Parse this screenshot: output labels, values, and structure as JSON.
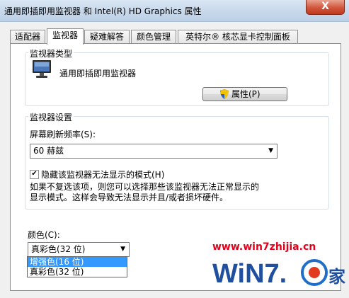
{
  "window": {
    "title": "通用即插即用监视器 和 Intel(R) HD Graphics 属性",
    "close_label": "X"
  },
  "tabs": [
    {
      "label": "适配器",
      "active": false
    },
    {
      "label": "监视器",
      "active": true
    },
    {
      "label": "疑难解答",
      "active": false
    },
    {
      "label": "颜色管理",
      "active": false
    },
    {
      "label": "英特尔® 核芯显卡控制面板",
      "active": false
    }
  ],
  "monitor_type": {
    "group_title": "监视器类型",
    "monitor_name": "通用即插即用监视器",
    "properties_button": "属性(P)"
  },
  "monitor_settings": {
    "group_title": "监视器设置",
    "refresh_label": "屏幕刷新频率(S):",
    "refresh_value": "60 赫兹",
    "hide_modes_checked": true,
    "hide_modes_label": "隐藏该监视器无法显示的模式(H)",
    "note_line1": "如果不复选该项，则您可以选择那些该监视器无法正常显示的",
    "note_line2": "显示模式。这样会导致无法显示并且/或者损坏硬件。"
  },
  "colors": {
    "label": "颜色(C):",
    "selected": "真彩色(32 位)",
    "options": [
      "增强色(16 位)",
      "真彩色(32 位)"
    ],
    "highlighted_index": 0
  },
  "watermark": {
    "url": "www.win7zhijia.cn",
    "logo_text": "WiN7.",
    "logo_suffix": "家"
  }
}
